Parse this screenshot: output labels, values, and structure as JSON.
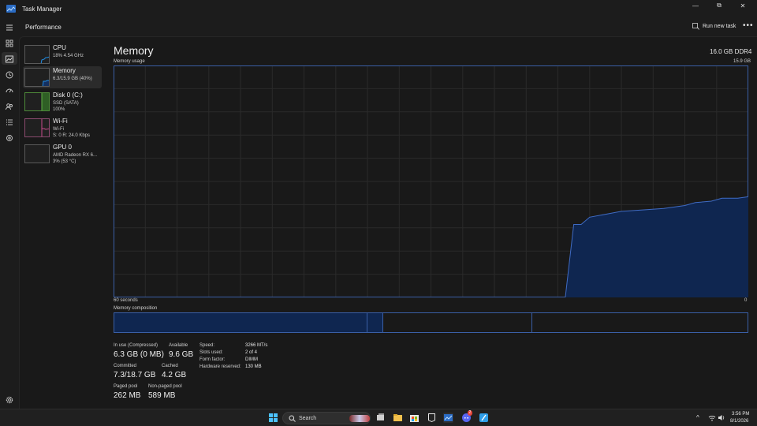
{
  "window": {
    "title": "Task Manager",
    "minimize_glyph": "—",
    "maximize_glyph": "⧉",
    "close_glyph": "✕"
  },
  "header": {
    "page_title": "Performance",
    "run_new_task": "Run new task",
    "more_glyph": "•••"
  },
  "devices": [
    {
      "name": "CPU",
      "sub1": "18% 4.54 GHz",
      "sub2": "",
      "color": "#1f8ee8"
    },
    {
      "name": "Memory",
      "sub1": "6.3/15.9 GB (40%)",
      "sub2": "",
      "color": "#1f8ee8"
    },
    {
      "name": "Disk 0 (C:)",
      "sub1": "SSD (SATA)",
      "sub2": "100%",
      "color": "#5fb043"
    },
    {
      "name": "Wi-Fi",
      "sub1": "Wi-Fi",
      "sub2": "S: 0 R: 24.0 Kbps",
      "color": "#c94a8c"
    },
    {
      "name": "GPU 0",
      "sub1": "AMD Radeon RX 6...",
      "sub2": "3% (53 °C)",
      "color": "#1f8ee8"
    }
  ],
  "main": {
    "title": "Memory",
    "mem_type": "16.0 GB DDR4",
    "usage_label": "Memory usage",
    "usage_max": "15.9 GB",
    "axis_left": "60 seconds",
    "axis_right": "0",
    "composition_label": "Memory composition",
    "accent": "#3a5fa6",
    "fill": "#0f2650"
  },
  "chart_data": {
    "type": "area",
    "x_range_seconds": [
      60,
      0
    ],
    "ylim": [
      0,
      15.9
    ],
    "points": [
      [
        17.3,
        0
      ],
      [
        16.5,
        5.0
      ],
      [
        15.8,
        5.0
      ],
      [
        15.0,
        5.5
      ],
      [
        13.5,
        5.7
      ],
      [
        12.0,
        5.9
      ],
      [
        10.0,
        6.0
      ],
      [
        8.0,
        6.1
      ],
      [
        6.0,
        6.3
      ],
      [
        5.0,
        6.5
      ],
      [
        3.5,
        6.6
      ],
      [
        2.5,
        6.8
      ],
      [
        1.0,
        6.8
      ],
      [
        0,
        6.9
      ]
    ]
  },
  "composition": {
    "in_use_fraction": 0.4,
    "modified_fraction": 0.025,
    "standby_fraction": 0.235,
    "free_fraction": 0.34
  },
  "stats": {
    "in_use_label": "In use (Compressed)",
    "in_use_value": "6.3 GB (0 MB)",
    "available_label": "Available",
    "available_value": "9.6 GB",
    "committed_label": "Committed",
    "committed_value": "7.3/18.7 GB",
    "cached_label": "Cached",
    "cached_value": "4.2 GB",
    "paged_pool_label": "Paged pool",
    "paged_pool_value": "262 MB",
    "non_paged_pool_label": "Non-paged pool",
    "non_paged_pool_value": "589 MB"
  },
  "specs": [
    {
      "label": "Speed:",
      "value": "3266 MT/s"
    },
    {
      "label": "Slots used:",
      "value": "2 of 4"
    },
    {
      "label": "Form factor:",
      "value": "DIMM"
    },
    {
      "label": "Hardware reserved:",
      "value": "130 MB"
    }
  ],
  "taskbar": {
    "search_text": "Search",
    "time": "3:56 PM",
    "date": "8/1/2026",
    "tray_chevron": "^",
    "badge_count": "2"
  }
}
